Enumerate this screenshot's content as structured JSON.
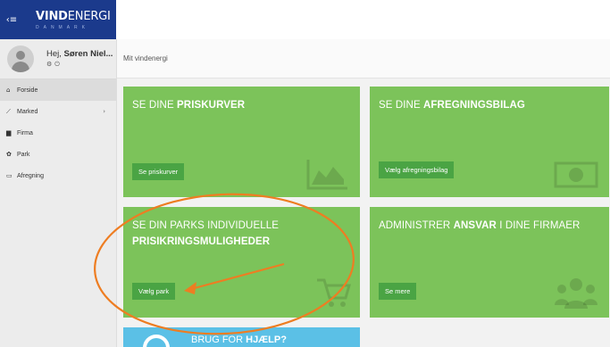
{
  "header": {
    "logo_bold": "VIND",
    "logo_light": "ENERGI",
    "logo_sub": "DANMARK",
    "menu_toggle_glyph": "‹≡"
  },
  "sidebar": {
    "greeting_prefix": "Hej, ",
    "user_name": "Søren Niel...",
    "items": [
      {
        "label": "Forside",
        "icon": "home-icon",
        "glyph": "⌂"
      },
      {
        "label": "Marked",
        "icon": "line-chart-icon",
        "glyph": "⟋",
        "chevron": "›"
      },
      {
        "label": "Firma",
        "icon": "building-icon",
        "glyph": "▆"
      },
      {
        "label": "Park",
        "icon": "wind-park-icon",
        "glyph": "✿"
      },
      {
        "label": "Afregning",
        "icon": "invoice-icon",
        "glyph": "▭"
      }
    ]
  },
  "breadcrumb": {
    "text": "Mit vindenergi"
  },
  "tiles": [
    {
      "title_light": "SE DINE ",
      "title_bold": "PRISKURVER",
      "button": "Se priskurver",
      "icon": "area-chart-icon"
    },
    {
      "title_light": "SE DINE ",
      "title_bold": "AFREGNINGSBILAG",
      "button": "Vælg afregningsbilag",
      "icon": "banknote-icon"
    },
    {
      "title_light": "SE DIN PARKS INDIVIDUELLE",
      "title_bold": "PRISIKRINGSMULIGHEDER",
      "button": "Vælg park",
      "icon": "shopping-cart-icon"
    },
    {
      "title_light": "ADMINISTRER ",
      "title_bold": "ANSVAR",
      "title_tail": " I DINE FIRMAER",
      "button": "Se mere",
      "icon": "users-icon"
    }
  ],
  "help_tile": {
    "title_light": "BRUG FOR ",
    "title_bold": "HJÆLP?"
  },
  "colors": {
    "logo_bg": "#1b3a8c",
    "tile_green": "#7cc35a",
    "button_green": "#4aa444",
    "help_blue": "#5bc0e6",
    "annotation_orange": "#ee7d22"
  }
}
